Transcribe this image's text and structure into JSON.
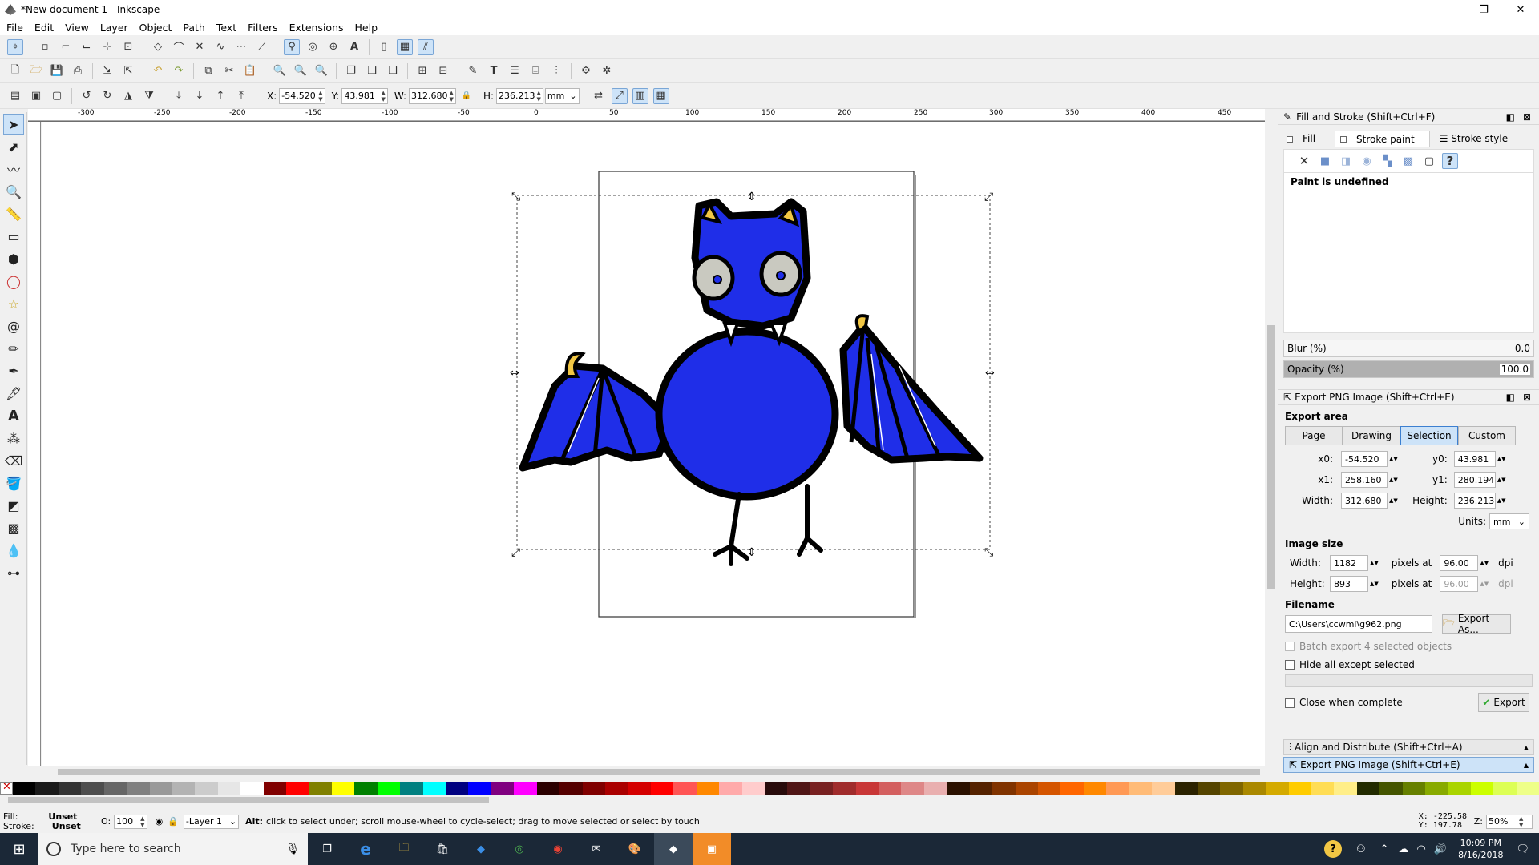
{
  "window": {
    "title": "*New document 1 - Inkscape",
    "minimize": "—",
    "maximize": "❐",
    "close": "✕"
  },
  "menu": [
    "File",
    "Edit",
    "View",
    "Layer",
    "Object",
    "Path",
    "Text",
    "Filters",
    "Extensions",
    "Help"
  ],
  "selectbar": {
    "x_label": "X:",
    "x_value": "-54.520",
    "y_label": "Y:",
    "y_value": "43.981",
    "w_label": "W:",
    "w_value": "312.680",
    "h_label": "H:",
    "h_value": "236.213",
    "unit": "mm"
  },
  "rulers": {
    "h_ticks": [
      "-300",
      "-250",
      "-200",
      "-150",
      "-100",
      "-50",
      "0",
      "50",
      "100",
      "150",
      "200",
      "250",
      "300",
      "350",
      "400",
      "450"
    ]
  },
  "fill_stroke": {
    "title": "Fill and Stroke (Shift+Ctrl+F)",
    "tabs": [
      "Fill",
      "Stroke paint",
      "Stroke style"
    ],
    "paint_status": "Paint is undefined",
    "blur_label": "Blur (%)",
    "blur_value": "0.0",
    "opacity_label": "Opacity (%)",
    "opacity_value": "100.0"
  },
  "export": {
    "title": "Export PNG Image (Shift+Ctrl+E)",
    "area_label": "Export area",
    "area_buttons": [
      "Page",
      "Drawing",
      "Selection",
      "Custom"
    ],
    "x0_label": "x0:",
    "x0": "-54.520",
    "y0_label": "y0:",
    "y0": "43.981",
    "x1_label": "x1:",
    "x1": "258.160",
    "y1_label": "y1:",
    "y1": "280.194",
    "width_label": "Width:",
    "width": "312.680",
    "height_label": "Height:",
    "height": "236.213",
    "units_label": "Units:",
    "units": "mm",
    "image_size_label": "Image size",
    "img_width_label": "Width:",
    "img_width": "1182",
    "img_height_label": "Height:",
    "img_height": "893",
    "pixels_at": "pixels at",
    "dpi1": "96.00",
    "dpi2": "96.00",
    "dpi_label": "dpi",
    "filename_label": "Filename",
    "filename": "C:\\Users\\ccwmi\\g962.png",
    "export_as": "Export As...",
    "batch": "Batch export 4 selected objects",
    "hide_all": "Hide all except selected",
    "close_when": "Close when complete",
    "export_btn": "Export"
  },
  "docked": {
    "align": "Align and Distribute (Shift+Ctrl+A)",
    "export": "Export PNG Image (Shift+Ctrl+E)"
  },
  "status": {
    "fill_label": "Fill:",
    "fill_value": "Unset",
    "stroke_label": "Stroke:",
    "stroke_value": "Unset",
    "opacity_label": "O:",
    "opacity_value": "100",
    "layer": "-Layer 1",
    "message_bold": "Alt:",
    "message": "click to select under; scroll mouse-wheel to cycle-select; drag to move selected or select by touch",
    "cursor_x": "X: -225.58",
    "cursor_y": "Y: 197.78",
    "zoom_label": "Z:",
    "zoom": "50%"
  },
  "taskbar": {
    "search_placeholder": "Type here to search",
    "time": "10:09 PM",
    "date": "8/16/2018"
  },
  "colors": {
    "bat_blue": "#1f2ee8",
    "yellow": "#f2c744",
    "selection_blue": "#cde3f8"
  }
}
